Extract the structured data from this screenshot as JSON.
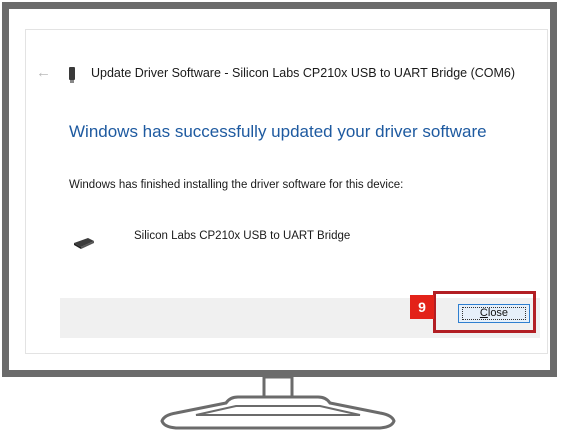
{
  "dialog": {
    "title": "Update Driver Software - Silicon Labs CP210x USB to UART Bridge (COM6)",
    "heading": "Windows has successfully updated your driver software",
    "message": "Windows has finished installing the driver software for this device:",
    "device_name": "Silicon Labs CP210x USB to UART Bridge",
    "back_icon": "back-arrow-icon",
    "device_icon": "usb-device-icon"
  },
  "annotation": {
    "step_number": "9",
    "step_color": "#e32219",
    "highlight_color": "#b21e23"
  },
  "buttons": {
    "close_label_mnemonic": "C",
    "close_label_rest": "lose"
  },
  "colors": {
    "heading": "#1e5aa0",
    "monitor_frame": "#6b6b6b"
  }
}
